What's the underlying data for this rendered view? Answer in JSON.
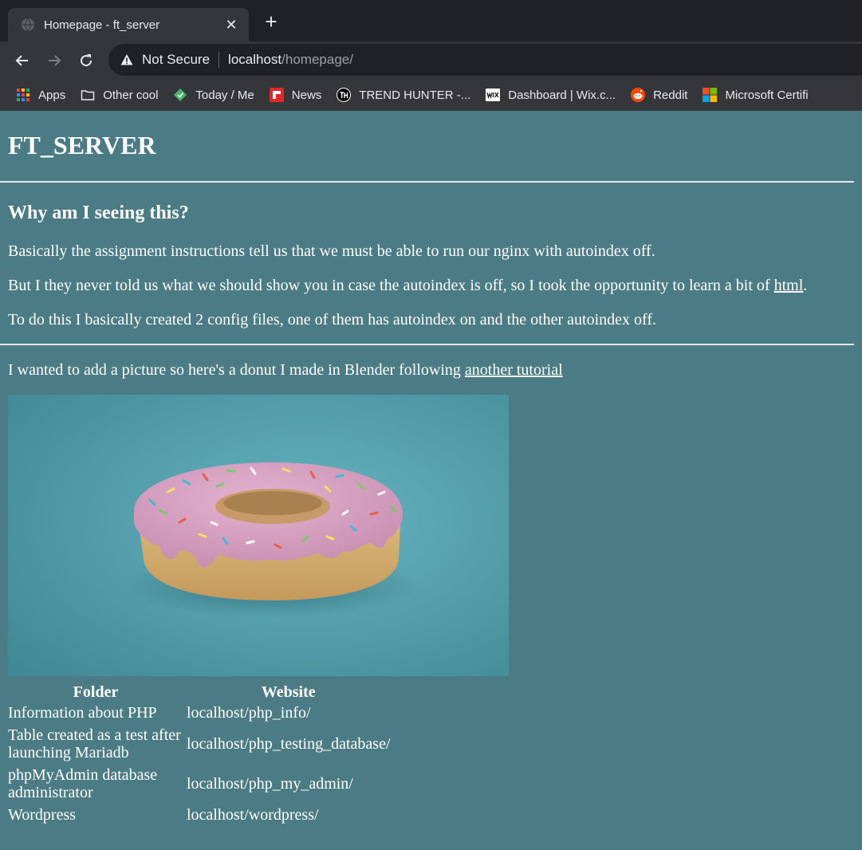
{
  "browser": {
    "tab_title": "Homepage - ft_server",
    "close_glyph": "✕",
    "newtab_glyph": "+",
    "address": {
      "security_label": "Not Secure",
      "host": "localhost",
      "path": "/homepage/"
    },
    "bookmarks": [
      {
        "label": "Apps",
        "icon": "apps-grid-icon"
      },
      {
        "label": "Other cool",
        "icon": "folder-icon"
      },
      {
        "label": "Today / Me",
        "icon": "today-me-icon"
      },
      {
        "label": "News",
        "icon": "flipboard-icon"
      },
      {
        "label": "TREND HUNTER -...",
        "icon": "trend-hunter-icon"
      },
      {
        "label": "Dashboard | Wix.c...",
        "icon": "wix-icon"
      },
      {
        "label": "Reddit",
        "icon": "reddit-icon"
      },
      {
        "label": "Microsoft Certifi",
        "icon": "microsoft-icon"
      }
    ]
  },
  "page": {
    "title": "FT_SERVER",
    "heading": "Why am I seeing this?",
    "p1": "Basically the assignment instructions tell us that we must be able to run our nginx with autoindex off.",
    "p2_before": "But I they never told us what we should show you in case the autoindex is off, so I took the opportunity to learn a bit of ",
    "p2_link": "html",
    "p2_after": ".",
    "p3": "To do this I basically created 2 config files, one of them has autoindex on and the other autoindex off.",
    "p4_before": "I wanted to add a picture so here's a donut I made in Blender following ",
    "p4_link": "another tutorial",
    "table": {
      "headers": [
        "Folder",
        "Website"
      ],
      "rows": [
        [
          "Information about PHP",
          "localhost/php_info/"
        ],
        [
          "Table created as a test after launching Mariadb",
          "localhost/php_testing_database/"
        ],
        [
          "phpMyAdmin database administrator",
          "localhost/php_my_admin/"
        ],
        [
          "Wordpress",
          "localhost/wordpress/"
        ]
      ]
    }
  },
  "colors": {
    "page_bg": "#4b7c85",
    "chrome_dark": "#202124",
    "chrome_mid": "#35363a",
    "donut_bg": "#58a6b3",
    "frosting": "#d59fc0"
  }
}
